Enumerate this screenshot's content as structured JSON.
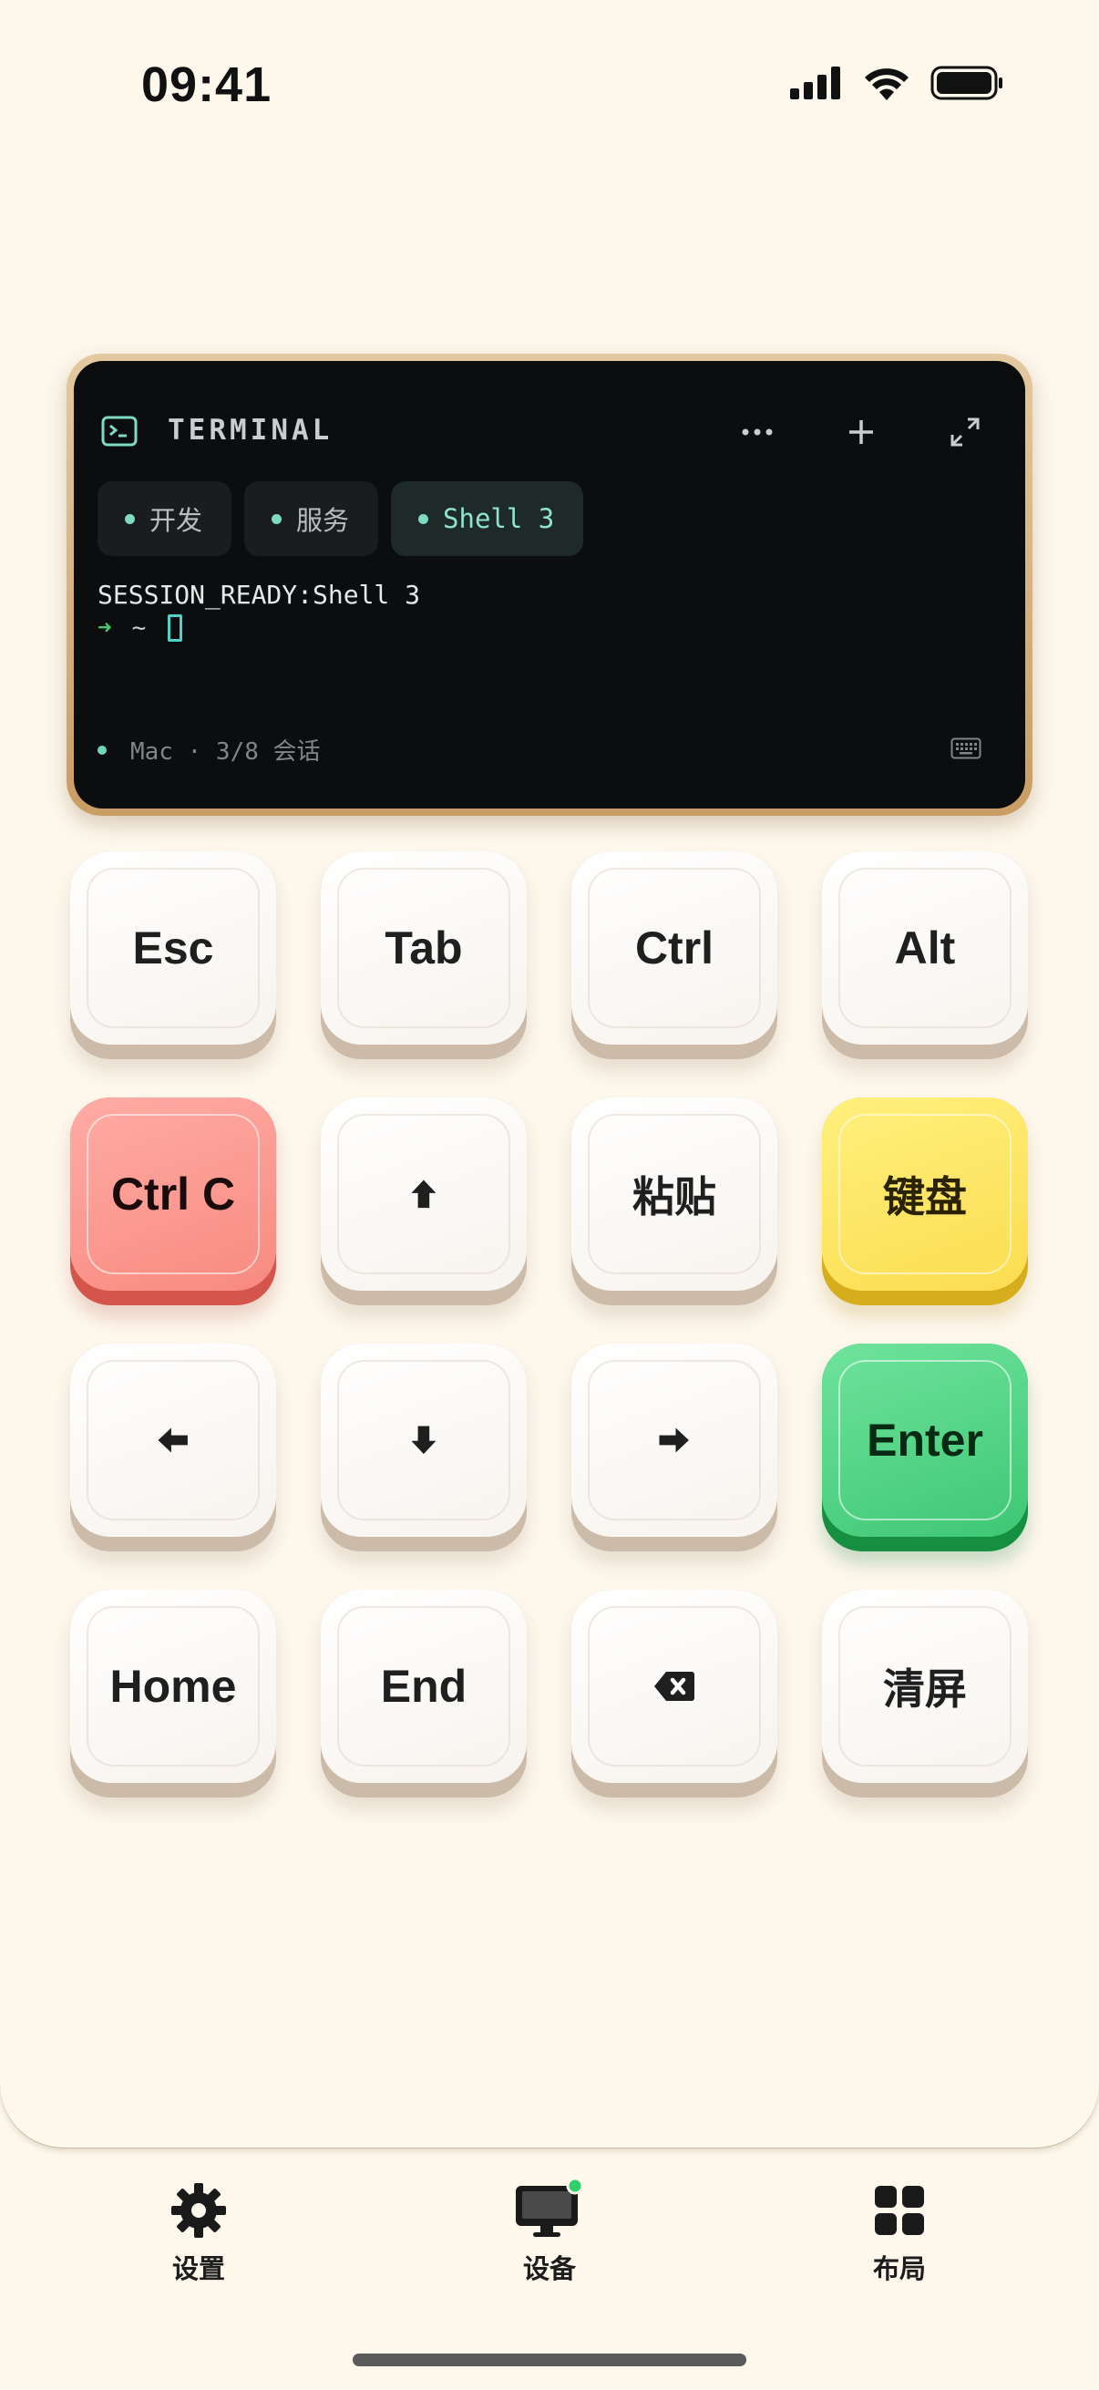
{
  "status_bar": {
    "time": "09:41"
  },
  "terminal": {
    "title": "TERMINAL",
    "tabs": [
      {
        "label": "开发",
        "active": false
      },
      {
        "label": "服务",
        "active": false
      },
      {
        "label": "Shell 3",
        "active": true
      }
    ],
    "output_line": "SESSION_READY:Shell 3",
    "prompt_arrow": "➜",
    "prompt_path": "~",
    "footer": "Mac · 3/8 会话",
    "accent": "#7fd9c3"
  },
  "keys": [
    {
      "label": "Esc",
      "style": "white"
    },
    {
      "label": "Tab",
      "style": "white"
    },
    {
      "label": "Ctrl",
      "style": "white"
    },
    {
      "label": "Alt",
      "style": "white"
    },
    {
      "label": "Ctrl C",
      "style": "red"
    },
    {
      "label": "",
      "icon": "arrow-up-icon",
      "style": "white"
    },
    {
      "label": "粘贴",
      "style": "white"
    },
    {
      "label": "键盘",
      "style": "yellow"
    },
    {
      "label": "",
      "icon": "arrow-left-icon",
      "style": "white"
    },
    {
      "label": "",
      "icon": "arrow-down-icon",
      "style": "white"
    },
    {
      "label": "",
      "icon": "arrow-right-icon",
      "style": "white"
    },
    {
      "label": "Enter",
      "style": "green"
    },
    {
      "label": "Home",
      "style": "white"
    },
    {
      "label": "End",
      "style": "white"
    },
    {
      "label": "",
      "icon": "backspace-icon",
      "style": "white"
    },
    {
      "label": "清屏",
      "style": "white"
    }
  ],
  "tabbar": {
    "items": [
      {
        "label": "设置",
        "icon": "gear-icon"
      },
      {
        "label": "设备",
        "icon": "monitor-icon",
        "badge_color": "#2fcf6a"
      },
      {
        "label": "布局",
        "icon": "grid-icon"
      }
    ]
  }
}
